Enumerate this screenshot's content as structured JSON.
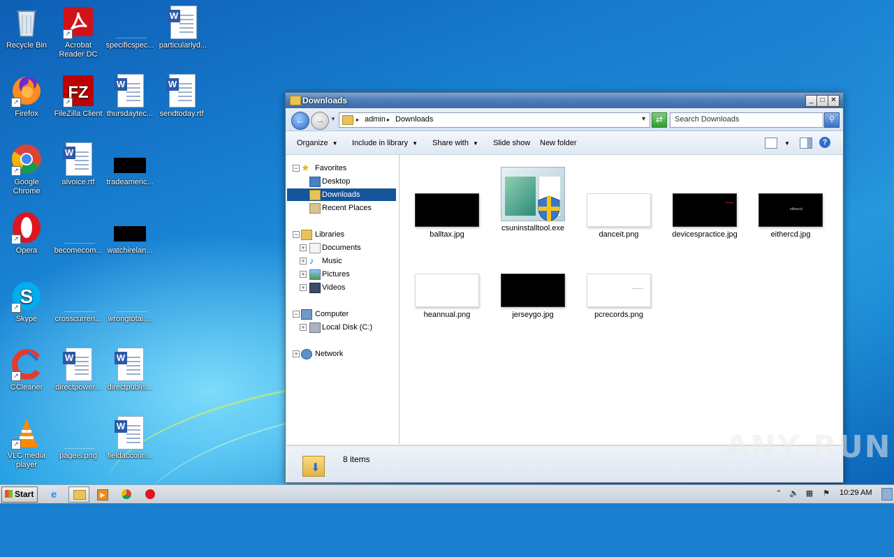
{
  "desktop": {
    "icons": [
      {
        "label": "Recycle Bin",
        "icon": "recycle-bin-icon"
      },
      {
        "label": "Acrobat Reader DC",
        "label_line1": "Acrobat",
        "label_line2": "Reader DC",
        "icon": "acrobat-icon"
      },
      {
        "label": "specificspec...",
        "icon": "blank-file-icon"
      },
      {
        "label": "particularlyd...",
        "icon": "word-document-icon"
      },
      {
        "label": "Firefox",
        "icon": "firefox-icon"
      },
      {
        "label": "FileZilla Client",
        "icon": "filezilla-icon"
      },
      {
        "label": "thursdaytec...",
        "icon": "word-document-icon"
      },
      {
        "label": "sendtoday.rtf",
        "icon": "word-document-icon"
      },
      {
        "label": "Google Chrome",
        "label_line1": "Google",
        "label_line2": "Chrome",
        "icon": "chrome-icon"
      },
      {
        "label": "alvoice.rtf",
        "icon": "word-document-icon"
      },
      {
        "label": "tradeameric...",
        "icon": "black-image-icon"
      },
      {
        "label": "Opera",
        "icon": "opera-icon"
      },
      {
        "label": "becomecom...",
        "icon": "blank-file-icon"
      },
      {
        "label": "watchirelan...",
        "icon": "black-image-icon"
      },
      {
        "label": "Skype",
        "icon": "skype-icon"
      },
      {
        "label": "crosscurren...",
        "icon": "blank-file-icon"
      },
      {
        "label": "wrongtotal....",
        "icon": "blank-file-icon"
      },
      {
        "label": "CCleaner",
        "icon": "ccleaner-icon"
      },
      {
        "label": "directpower...",
        "icon": "word-document-icon"
      },
      {
        "label": "directpublis...",
        "icon": "word-document-icon"
      },
      {
        "label": "VLC media player",
        "label_line1": "VLC media",
        "label_line2": "player",
        "icon": "vlc-icon"
      },
      {
        "label": "pageis.png",
        "icon": "blank-file-icon"
      },
      {
        "label": "fieldaccoun...",
        "icon": "word-document-icon"
      }
    ]
  },
  "explorer": {
    "title": "Downloads",
    "address": {
      "crumbs": [
        "admin",
        "Downloads"
      ]
    },
    "search": {
      "placeholder": "Search Downloads"
    },
    "toolbar": {
      "organize": "Organize",
      "include_in_library": "Include in library",
      "share_with": "Share with",
      "slide_show": "Slide show",
      "new_folder": "New folder"
    },
    "nav": {
      "favorites": "Favorites",
      "desktop": "Desktop",
      "downloads": "Downloads",
      "recent_places": "Recent Places",
      "libraries": "Libraries",
      "documents": "Documents",
      "music": "Music",
      "pictures": "Pictures",
      "videos": "Videos",
      "computer": "Computer",
      "local_disk": "Local Disk (C:)",
      "network": "Network"
    },
    "files": [
      {
        "name": "balltax.jpg",
        "thumb": "black"
      },
      {
        "name": "csuninstalltool.exe",
        "thumb": "installer"
      },
      {
        "name": "danceit.png",
        "thumb": "white"
      },
      {
        "name": "devicespractice.jpg",
        "thumb": "black"
      },
      {
        "name": "eithercd.jpg",
        "thumb": "black",
        "thumb_text": "eithercd"
      },
      {
        "name": "heannual.png",
        "thumb": "white"
      },
      {
        "name": "jerseygo.jpg",
        "thumb": "black"
      },
      {
        "name": "pcrecords.png",
        "thumb": "white"
      }
    ],
    "status": {
      "item_count": "8 items"
    }
  },
  "watermark": "ANY RUN",
  "taskbar": {
    "start_label": "Start",
    "clock": "10:29 AM"
  }
}
